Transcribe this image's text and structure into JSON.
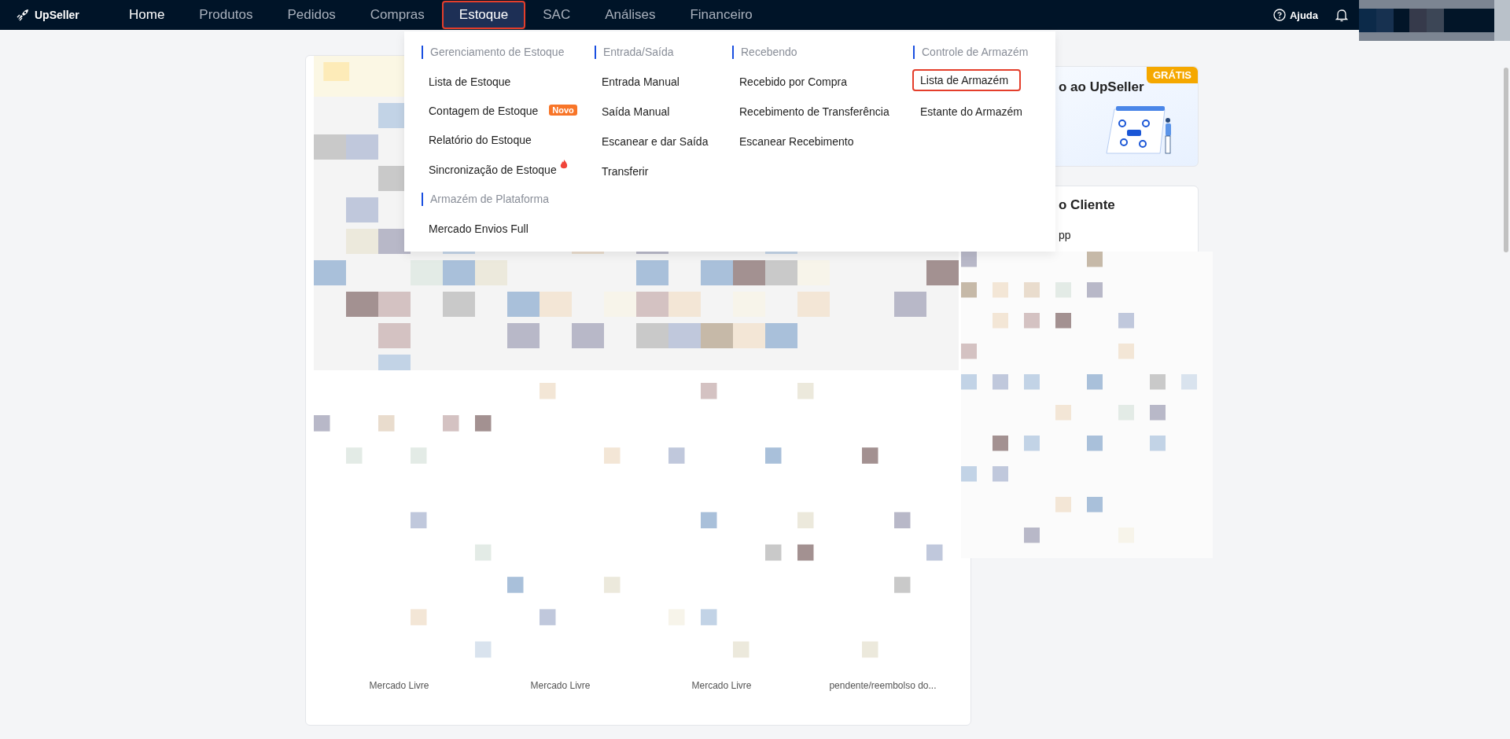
{
  "brand": "UpSeller",
  "nav": [
    {
      "label": "Home",
      "selected": false,
      "highlighted": false,
      "bright": true
    },
    {
      "label": "Produtos",
      "selected": false,
      "highlighted": false,
      "bright": false
    },
    {
      "label": "Pedidos",
      "selected": false,
      "highlighted": false,
      "bright": false
    },
    {
      "label": "Compras",
      "selected": false,
      "highlighted": false,
      "bright": false
    },
    {
      "label": "Estoque",
      "selected": true,
      "highlighted": true,
      "bright": true
    },
    {
      "label": "SAC",
      "selected": false,
      "highlighted": false,
      "bright": false
    },
    {
      "label": "Análises",
      "selected": false,
      "highlighted": false,
      "bright": false
    },
    {
      "label": "Financeiro",
      "selected": false,
      "highlighted": false,
      "bright": false
    }
  ],
  "help": "Ajuda",
  "menu": {
    "columns": [
      {
        "sections": [
          {
            "title": "Gerenciamento de Estoque",
            "items": [
              {
                "label": "Lista de Estoque",
                "highlighted": false,
                "hot": false
              },
              {
                "label": "Contagem de Estoque",
                "highlighted": false,
                "hot": false,
                "badge": "Novo"
              },
              {
                "label": "Relatório do Estoque",
                "highlighted": false,
                "hot": false
              },
              {
                "label": "Sincronização de Estoque",
                "highlighted": false,
                "hot": true
              }
            ]
          },
          {
            "title": "Armazém de Plataforma",
            "items": [
              {
                "label": "Mercado Envios Full",
                "highlighted": false,
                "hot": false
              }
            ]
          }
        ]
      },
      {
        "sections": [
          {
            "title": "Entrada/Saída",
            "items": [
              {
                "label": "Entrada Manual",
                "highlighted": false,
                "hot": false
              },
              {
                "label": "Saída Manual",
                "highlighted": false,
                "hot": false
              },
              {
                "label": "Escanear e dar Saída",
                "highlighted": false,
                "hot": false
              },
              {
                "label": "Transferir",
                "highlighted": false,
                "hot": false
              }
            ]
          }
        ]
      },
      {
        "sections": [
          {
            "title": "Recebendo",
            "items": [
              {
                "label": "Recebido por Compra",
                "highlighted": false,
                "hot": false
              },
              {
                "label": "Recebimento de Transferência",
                "highlighted": false,
                "hot": false
              },
              {
                "label": "Escanear Recebimento",
                "highlighted": false,
                "hot": false
              }
            ]
          }
        ]
      },
      {
        "sections": [
          {
            "title": "Controle de Armazém",
            "items": [
              {
                "label": "Lista de Armazém",
                "highlighted": true,
                "hot": false
              },
              {
                "label": "Estante do Armazém",
                "highlighted": false,
                "hot": false
              }
            ]
          }
        ]
      }
    ]
  },
  "promo_card": {
    "title": "o ao UpSeller",
    "badge": "GRÁTIS"
  },
  "service_card": {
    "title": "o Cliente",
    "line": "pp"
  },
  "platform_labels": [
    "Mercado Livre",
    "Mercado Livre",
    "Mercado Livre",
    "pendente/reembolso do..."
  ]
}
